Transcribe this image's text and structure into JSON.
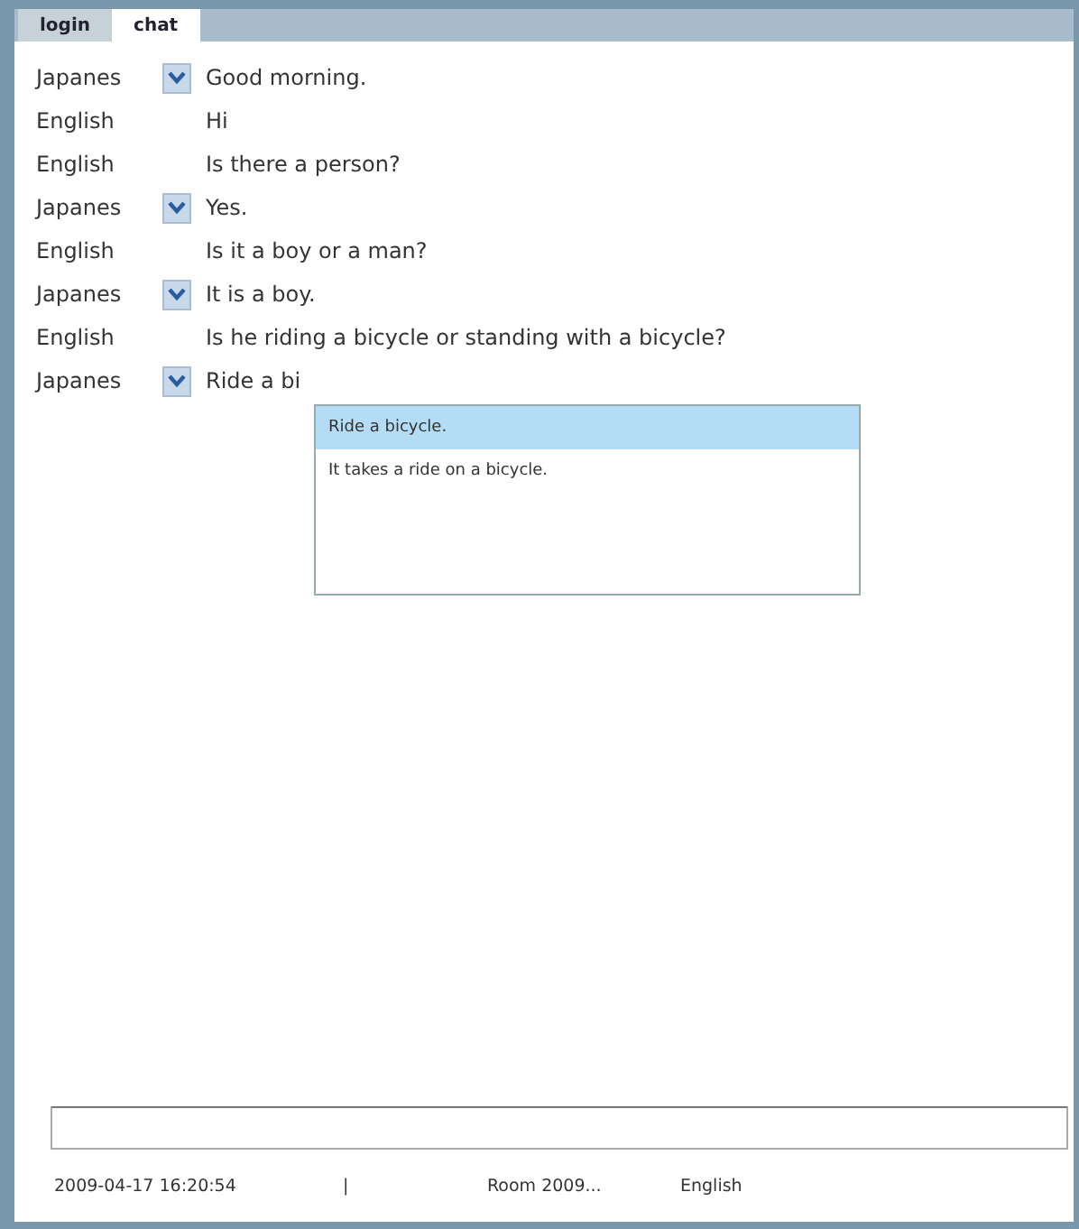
{
  "tabs": [
    {
      "label": "login",
      "selected": false
    },
    {
      "label": "chat",
      "selected": true
    }
  ],
  "messages": [
    {
      "language": "Japanes",
      "kind": "dropdown",
      "text": "Good morning."
    },
    {
      "language": "English",
      "kind": "plain",
      "text": "Hi"
    },
    {
      "language": "English",
      "kind": "plain",
      "text": "Is there a person?"
    },
    {
      "language": "Japanes",
      "kind": "dropdown",
      "text": "Yes."
    },
    {
      "language": "English",
      "kind": "plain",
      "text": "Is it a boy or a man?"
    },
    {
      "language": "Japanes",
      "kind": "dropdown",
      "text": "It is a boy."
    },
    {
      "language": "English",
      "kind": "plain",
      "text": "Is he riding a bicycle or standing with a bicycle?"
    },
    {
      "language": "Japanes",
      "kind": "dropdown",
      "text": "Ride a bi"
    }
  ],
  "suggestions": [
    {
      "text": "Ride a bicycle.",
      "selected": true
    },
    {
      "text": "It takes a ride on a bicycle.",
      "selected": false
    }
  ],
  "status_bar": {
    "timestamp": "2009-04-17 16:20:54",
    "separator": "|",
    "room": "Room 2009...",
    "language": "English"
  }
}
